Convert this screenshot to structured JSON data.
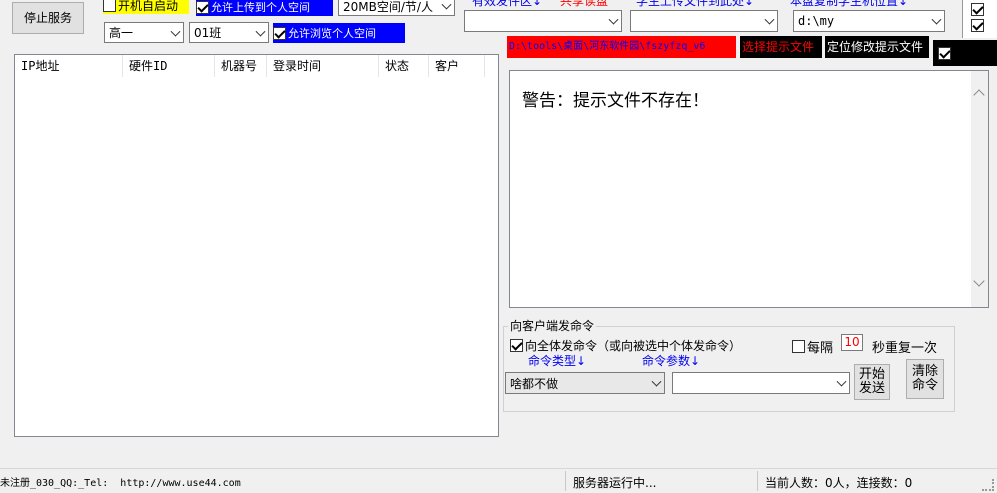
{
  "toolbar": {
    "stop_service": "停止服务",
    "autostart": "开机自启动",
    "upload_space": "允许上传到个人空间",
    "space_size": "20MB空间/节/人",
    "grade": "高一",
    "class": "01班",
    "browse_space": "允许浏览个人空间",
    "link1": "有效发件区↓",
    "link2": "共享读盘",
    "link3": "学生上传文件到此处↓",
    "link4": "本盘复制学生机位置↓",
    "dest_path": "d:\\my"
  },
  "hint": {
    "path": "D:\\tools\\桌面\\河东软件园\\fszyfzq_v6",
    "select_btn": "选择提示文件",
    "locate_btn": "定位修改提示文件"
  },
  "table": {
    "headers": [
      "IP地址",
      "硬件ID",
      "机器号",
      "登录时间",
      "状态",
      "客户"
    ]
  },
  "message": "警告：提示文件不存在！",
  "command": {
    "group_title": "向客户端发命令",
    "send_all": "向全体发命令（或向被选中个体发命令）",
    "every": "每隔",
    "interval": "10",
    "repeat": "秒重复一次",
    "cmd_type_label": "命令类型↓",
    "cmd_param_label": "命令参数↓",
    "cmd_type": "啥都不做",
    "cmd_param": "",
    "start_btn": "开始\n发送",
    "clear_btn": "清除\n命令"
  },
  "status": {
    "left": "未注册_030_QQ:_Tel:  http://www.use44.com",
    "center": "服务器运行中...",
    "right": "当前人数：0人，连接数：0"
  },
  "colors": {
    "yellow": "#ffff00",
    "blue": "#0000ff",
    "red": "#ff0000",
    "black": "#000000",
    "link": "#0000ee"
  }
}
